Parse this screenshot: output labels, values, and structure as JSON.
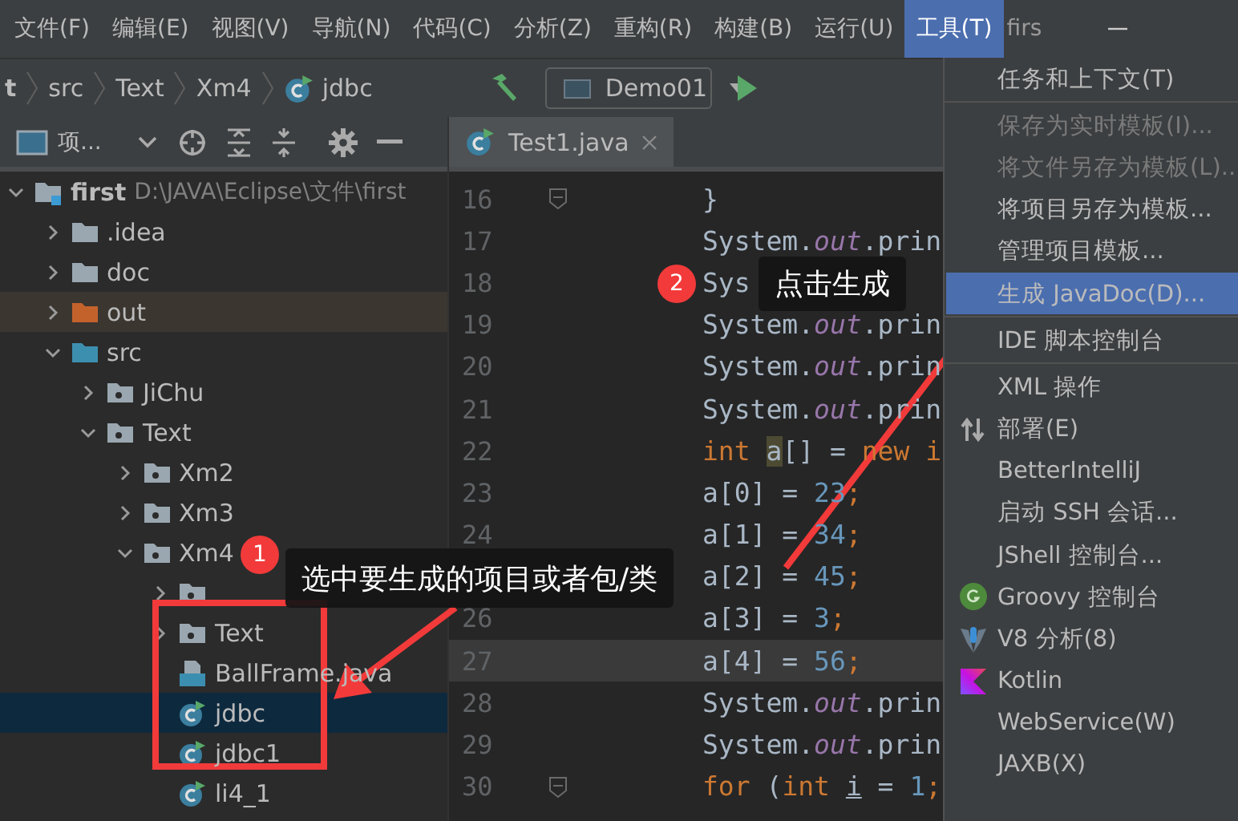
{
  "menubar": {
    "items": [
      {
        "label": "文件(F)",
        "selected": false
      },
      {
        "label": "编辑(E)",
        "selected": false
      },
      {
        "label": "视图(V)",
        "selected": false
      },
      {
        "label": "导航(N)",
        "selected": false
      },
      {
        "label": "代码(C)",
        "selected": false
      },
      {
        "label": "分析(Z)",
        "selected": false
      },
      {
        "label": "重构(R)",
        "selected": false
      },
      {
        "label": "构建(B)",
        "selected": false
      },
      {
        "label": "运行(U)",
        "selected": false
      },
      {
        "label": "工具(T)",
        "selected": true
      }
    ],
    "title": "firs"
  },
  "breadcrumb": [
    {
      "label": "t",
      "kind": "text"
    },
    {
      "label": "src",
      "kind": "text"
    },
    {
      "label": "Text",
      "kind": "text"
    },
    {
      "label": "Xm4",
      "kind": "text"
    },
    {
      "label": "jdbc",
      "kind": "class"
    }
  ],
  "run_config": "Demo01",
  "project_panel": {
    "title": "项...",
    "tree": [
      {
        "label": "first",
        "path": "D:\\JAVA\\Eclipse\\文件\\first",
        "kind": "module",
        "expanded": true,
        "selected": false,
        "children": [
          {
            "label": ".idea",
            "kind": "folder",
            "expanded": false,
            "selected": false
          },
          {
            "label": "doc",
            "kind": "folder",
            "expanded": false,
            "selected": false
          },
          {
            "label": "out",
            "kind": "excluded_folder",
            "expanded": false,
            "selected": false
          },
          {
            "label": "src",
            "kind": "source_folder",
            "expanded": true,
            "selected": false,
            "children": [
              {
                "label": "JiChu",
                "kind": "package",
                "expanded": false,
                "selected": false
              },
              {
                "label": "Text",
                "kind": "package",
                "expanded": true,
                "selected": false,
                "children": [
                  {
                    "label": "Xm2",
                    "kind": "package",
                    "expanded": false,
                    "selected": false
                  },
                  {
                    "label": "Xm3",
                    "kind": "package",
                    "expanded": false,
                    "selected": false
                  },
                  {
                    "label": "Xm4",
                    "kind": "package",
                    "expanded": true,
                    "selected": false,
                    "children": [
                      {
                        "kind": "package",
                        "expanded": false,
                        "selected": false
                      },
                      {
                        "label": "Text",
                        "kind": "package",
                        "expanded": false,
                        "selected": false
                      },
                      {
                        "label": "BallFrame.java",
                        "kind": "java_file",
                        "selected": false
                      },
                      {
                        "label": "jdbc",
                        "kind": "class",
                        "selected": true
                      },
                      {
                        "label": "jdbc1",
                        "kind": "class",
                        "selected": false
                      },
                      {
                        "label": "li4_1",
                        "kind": "class",
                        "selected": false
                      }
                    ]
                  }
                ]
              }
            ]
          }
        ]
      }
    ]
  },
  "editor_tab": {
    "label": "Test1.java",
    "selected": true
  },
  "editor": {
    "lines": [
      {
        "number": "16",
        "current": false,
        "fold": true,
        "tokens": [
          {
            "text": "}",
            "kind": "plain"
          }
        ]
      },
      {
        "number": "17",
        "current": false,
        "tokens": [
          {
            "text": "System.",
            "kind": "plain"
          },
          {
            "text": "out",
            "kind": "field"
          },
          {
            "text": ".prin",
            "kind": "plain"
          }
        ]
      },
      {
        "number": "18",
        "current": false,
        "tokens": [
          {
            "text": "Sys",
            "kind": "plain"
          }
        ]
      },
      {
        "number": "19",
        "current": false,
        "tokens": [
          {
            "text": "System.",
            "kind": "plain"
          },
          {
            "text": "out",
            "kind": "field"
          },
          {
            "text": ".prin",
            "kind": "plain"
          }
        ]
      },
      {
        "number": "20",
        "current": false,
        "tokens": [
          {
            "text": "System.",
            "kind": "plain"
          },
          {
            "text": "out",
            "kind": "field"
          },
          {
            "text": ".prin",
            "kind": "plain"
          }
        ]
      },
      {
        "number": "21",
        "current": false,
        "tokens": [
          {
            "text": "System.",
            "kind": "plain"
          },
          {
            "text": "out",
            "kind": "field"
          },
          {
            "text": ".prin",
            "kind": "plain"
          }
        ]
      },
      {
        "number": "22",
        "current": false,
        "tokens": [
          {
            "text": "int ",
            "kind": "keyword"
          },
          {
            "text": "a",
            "kind": "highlight"
          },
          {
            "text": "[] = ",
            "kind": "plain"
          },
          {
            "text": "new i",
            "kind": "keyword"
          }
        ]
      },
      {
        "number": "23",
        "current": false,
        "tokens": [
          {
            "text": "a[0] = ",
            "kind": "plain"
          },
          {
            "text": "23",
            "kind": "number"
          },
          {
            "text": ";",
            "kind": "keyword"
          }
        ]
      },
      {
        "number": "24",
        "current": false,
        "tokens": [
          {
            "text": "a[1] = ",
            "kind": "plain"
          },
          {
            "text": "34",
            "kind": "number"
          },
          {
            "text": ";",
            "kind": "keyword"
          }
        ]
      },
      {
        "current": false,
        "tokens": [
          {
            "text": "a[2] = ",
            "kind": "plain"
          },
          {
            "text": "45",
            "kind": "number"
          },
          {
            "text": ";",
            "kind": "keyword"
          }
        ]
      },
      {
        "number": "26",
        "current": false,
        "tokens": [
          {
            "text": "a[3] = ",
            "kind": "plain"
          },
          {
            "text": "3",
            "kind": "number"
          },
          {
            "text": ";",
            "kind": "keyword"
          }
        ]
      },
      {
        "number": "27",
        "current": true,
        "tokens": [
          {
            "text": "a[4] = ",
            "kind": "plain"
          },
          {
            "text": "56",
            "kind": "number"
          },
          {
            "text": ";",
            "kind": "keyword"
          }
        ]
      },
      {
        "number": "28",
        "current": false,
        "tokens": [
          {
            "text": "System.",
            "kind": "plain"
          },
          {
            "text": "out",
            "kind": "field"
          },
          {
            "text": ".prin",
            "kind": "plain"
          }
        ]
      },
      {
        "number": "29",
        "current": false,
        "tokens": [
          {
            "text": "System.",
            "kind": "plain"
          },
          {
            "text": "out",
            "kind": "field"
          },
          {
            "text": ".prin",
            "kind": "plain"
          }
        ]
      },
      {
        "number": "30",
        "current": false,
        "fold": true,
        "tokens": [
          {
            "text": "for",
            "kind": "keyword"
          },
          {
            "text": " (",
            "kind": "plain"
          },
          {
            "text": "int ",
            "kind": "keyword"
          },
          {
            "text": "i",
            "kind": "underline"
          },
          {
            "text": " = ",
            "kind": "plain"
          },
          {
            "text": "1",
            "kind": "number"
          },
          {
            "text": ";",
            "kind": "keyword"
          }
        ]
      }
    ]
  },
  "tools_menu": {
    "items": [
      {
        "kind": "item",
        "label": "任务和上下文(T)",
        "disabled": false,
        "selected": false
      },
      {
        "kind": "separator"
      },
      {
        "kind": "item",
        "label": "保存为实时模板(I)...",
        "disabled": true,
        "selected": false
      },
      {
        "kind": "item",
        "label": "将文件另存为模板(L)...",
        "disabled": true,
        "selected": false
      },
      {
        "kind": "item",
        "label": "将项目另存为模板...",
        "disabled": false,
        "selected": false
      },
      {
        "kind": "item",
        "label": "管理项目模板...",
        "disabled": false,
        "selected": false
      },
      {
        "kind": "item",
        "label": "生成 JavaDoc(D)...",
        "disabled": false,
        "selected": true
      },
      {
        "kind": "separator"
      },
      {
        "kind": "item",
        "label": "IDE 脚本控制台",
        "disabled": false,
        "selected": false
      },
      {
        "kind": "separator"
      },
      {
        "kind": "item",
        "label": "XML 操作",
        "disabled": false,
        "selected": false
      },
      {
        "kind": "item",
        "label": "部署(E)",
        "disabled": false,
        "selected": false
      },
      {
        "kind": "item",
        "label": "BetterIntelliJ",
        "disabled": false,
        "selected": false
      },
      {
        "kind": "item",
        "label": "启动 SSH 会话...",
        "disabled": false,
        "selected": false
      },
      {
        "kind": "item",
        "label": "JShell 控制台...",
        "disabled": false,
        "selected": false
      },
      {
        "kind": "item",
        "label": "Groovy 控制台",
        "disabled": false,
        "selected": false
      },
      {
        "kind": "item",
        "label": "V8 分析(8)",
        "disabled": false,
        "selected": false
      },
      {
        "kind": "item",
        "label": "Kotlin",
        "disabled": false,
        "selected": false
      },
      {
        "kind": "item",
        "label": "WebService(W)",
        "disabled": false,
        "selected": false
      },
      {
        "kind": "item",
        "label": "JAXB(X)",
        "disabled": false,
        "selected": false
      }
    ]
  },
  "annotations": [
    {
      "number": "1",
      "text": "选中要生成的项目或者包/类"
    },
    {
      "number": "2",
      "text": "点击生成"
    }
  ]
}
